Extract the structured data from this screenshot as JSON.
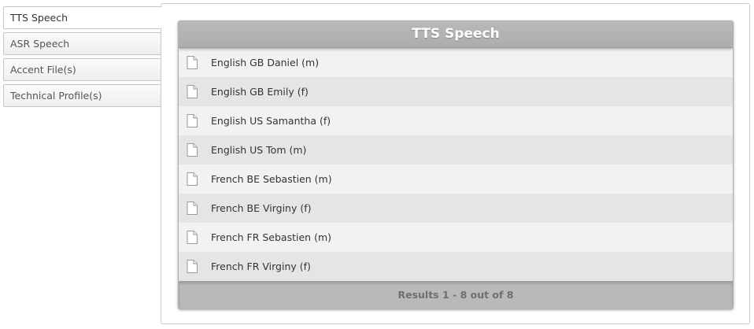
{
  "sidebar": {
    "tabs": [
      {
        "label": "TTS Speech",
        "active": true
      },
      {
        "label": "ASR Speech",
        "active": false
      },
      {
        "label": "Accent File(s)",
        "active": false
      },
      {
        "label": "Technical Profile(s)",
        "active": false
      }
    ]
  },
  "main": {
    "title": "TTS Speech",
    "items": [
      {
        "label": "English GB Daniel (m)",
        "icon": "document-icon"
      },
      {
        "label": "English GB Emily (f)",
        "icon": "document-icon"
      },
      {
        "label": "English US Samantha (f)",
        "icon": "document-icon"
      },
      {
        "label": "English US Tom (m)",
        "icon": "document-icon"
      },
      {
        "label": "French BE Sebastien (m)",
        "icon": "document-icon"
      },
      {
        "label": "French BE Virginy (f)",
        "icon": "document-icon"
      },
      {
        "label": "French FR Sebastien (m)",
        "icon": "document-icon"
      },
      {
        "label": "French FR Virginy (f)",
        "icon": "document-icon"
      }
    ],
    "footer": "Results 1 - 8 out of 8"
  },
  "colors": {
    "header_bg": "#b3b3b3",
    "row_odd": "#f2f2f2",
    "row_even": "#e5e5e5",
    "footer_text": "#6f6f6f"
  }
}
